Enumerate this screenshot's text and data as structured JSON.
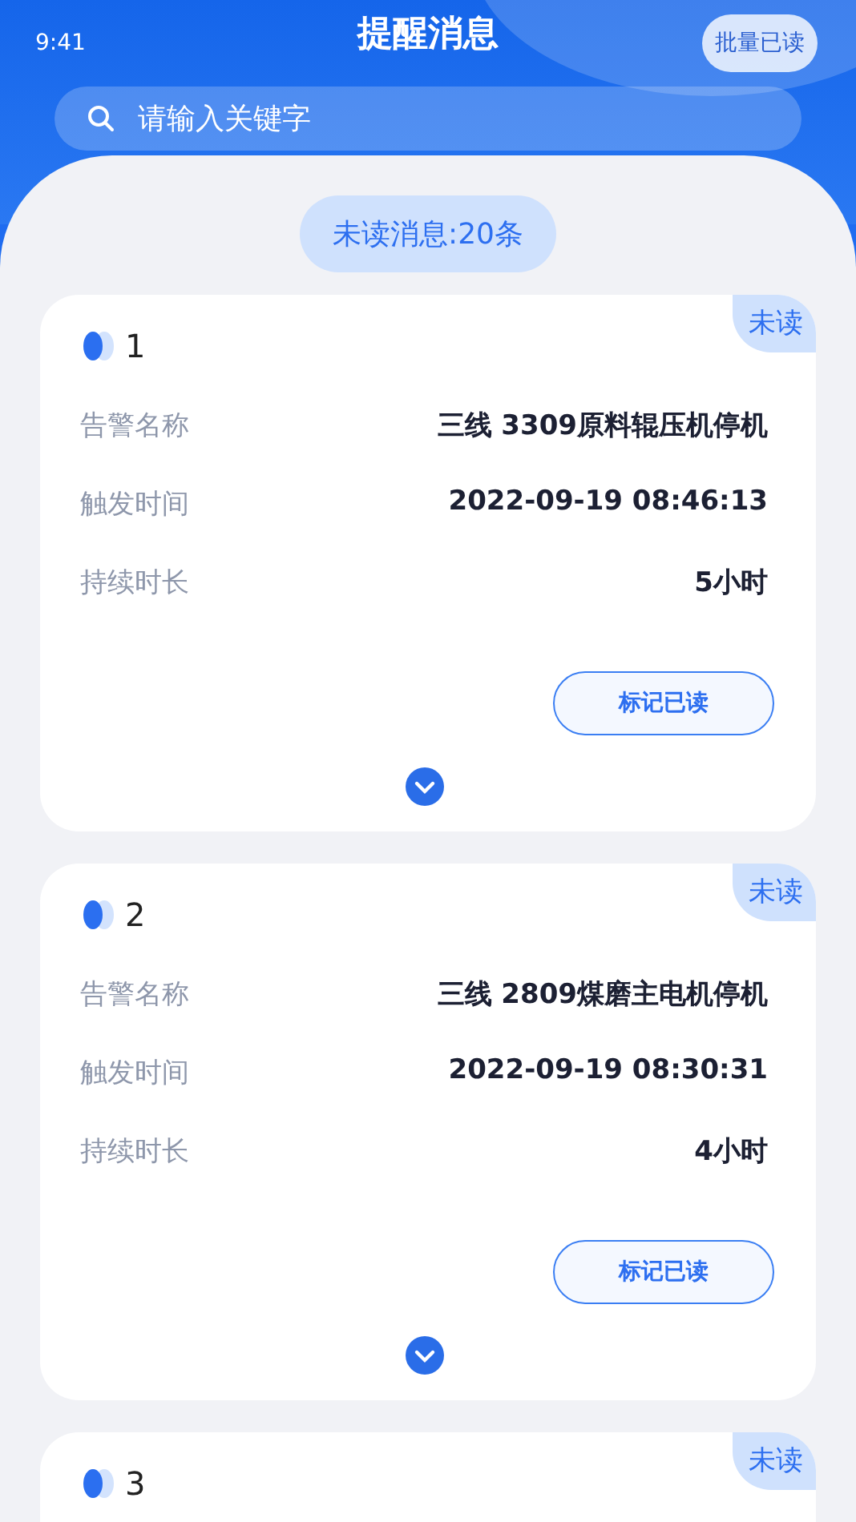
{
  "status_bar": {
    "time": "9:41"
  },
  "header": {
    "title": "提醒消息",
    "action": "批量已读"
  },
  "search": {
    "placeholder": "请输入关键字"
  },
  "unread_summary": "未读消息:20条",
  "messages": [
    {
      "number": "1",
      "badge": "未读",
      "fields": [
        {
          "label": "告警名称",
          "value": "三线 3309原料辊压机停机"
        },
        {
          "label": "触发时间",
          "value": "2022-09-19 08:46:13"
        },
        {
          "label": "持续时长",
          "value": "5小时"
        }
      ],
      "button": "标记已读"
    },
    {
      "number": "2",
      "badge": "未读",
      "fields": [
        {
          "label": "告警名称",
          "value": "三线 2809煤磨主电机停机"
        },
        {
          "label": "触发时间",
          "value": "2022-09-19 08:30:31"
        },
        {
          "label": "持续时长",
          "value": "4小时"
        }
      ],
      "button": "标记已读"
    },
    {
      "number": "3",
      "badge": "未读"
    }
  ]
}
